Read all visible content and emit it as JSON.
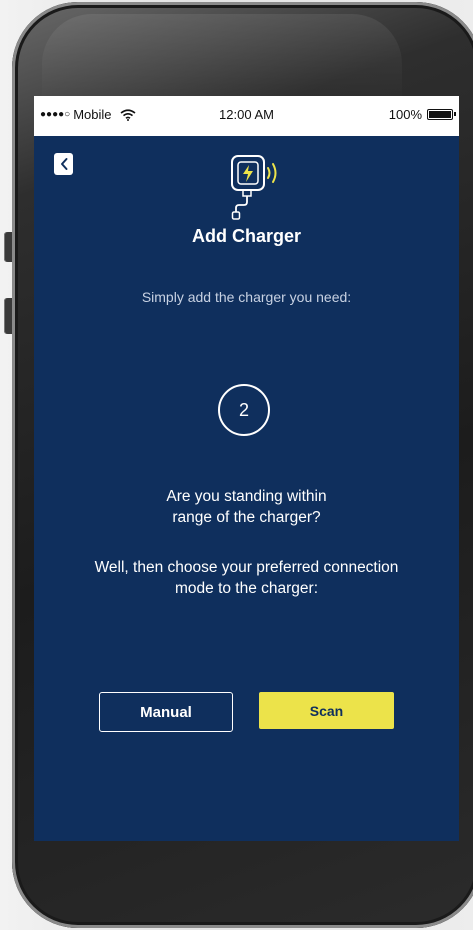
{
  "status_bar": {
    "carrier": "Mobile",
    "signal_icon": "signal-dots-icon",
    "wifi_icon": "wifi-icon",
    "time": "12:00 AM",
    "battery": "100%",
    "battery_icon": "battery-icon"
  },
  "header": {
    "back_icon": "chevron-left-icon",
    "charger_icon": "wireless-charger-icon",
    "title": "Add Charger"
  },
  "main": {
    "subtitle": "Simply add the charger you need:",
    "step_number": "2",
    "question_line1": "Are you standing within",
    "question_line2": "range of the charger?",
    "instruction_line1": "Well, then choose your preferred connection",
    "instruction_line2": "mode to the charger:"
  },
  "actions": {
    "manual_label": "Manual",
    "scan_label": "Scan"
  },
  "colors": {
    "screen_background": "#0f2f5d",
    "accent_yellow": "#ece34a",
    "text_white": "#ffffff",
    "subtitle_text": "#c8d2e3"
  }
}
